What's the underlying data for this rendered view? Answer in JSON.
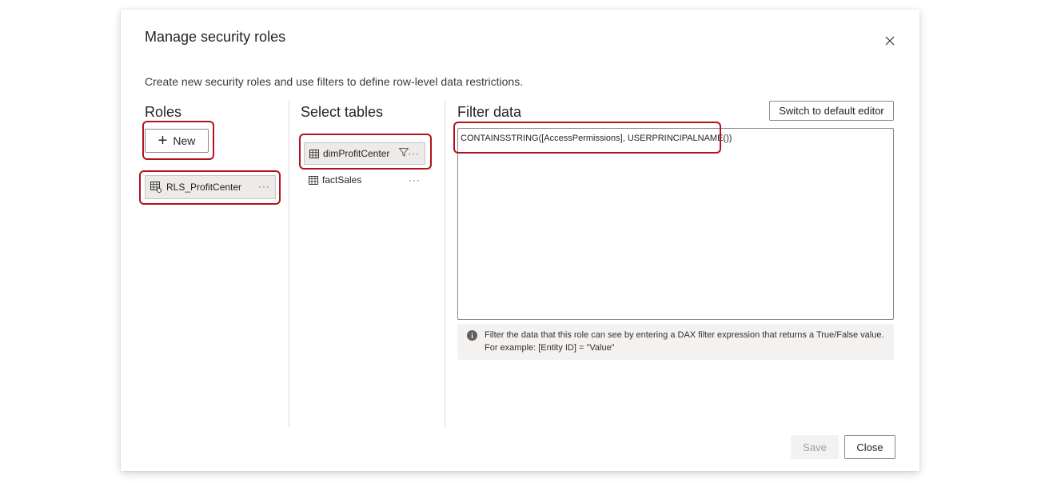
{
  "dialog": {
    "title": "Manage security roles",
    "description": "Create new security roles and use filters to define row-level data restrictions."
  },
  "roles": {
    "heading": "Roles",
    "new_label": "New",
    "items": [
      {
        "label": "RLS_ProfitCenter",
        "more": "···"
      }
    ]
  },
  "tables": {
    "heading": "Select tables",
    "items": [
      {
        "label": "dimProfitCenter",
        "more": "···",
        "has_filter": true
      },
      {
        "label": "factSales",
        "more": "···",
        "has_filter": false
      }
    ]
  },
  "filter": {
    "heading": "Filter data",
    "switch_label": "Switch to default editor",
    "expression": "CONTAINSSTRING([AccessPermissions], USERPRINCIPALNAME())",
    "info_line1": "Filter the data that this role can see by entering a DAX filter expression that returns a True/False value.",
    "info_line2": "For example: [Entity ID] = \"Value\""
  },
  "footer": {
    "save_label": "Save",
    "close_label": "Close"
  },
  "colors": {
    "highlight": "#b3141b",
    "selected_bg": "#edebe9"
  }
}
